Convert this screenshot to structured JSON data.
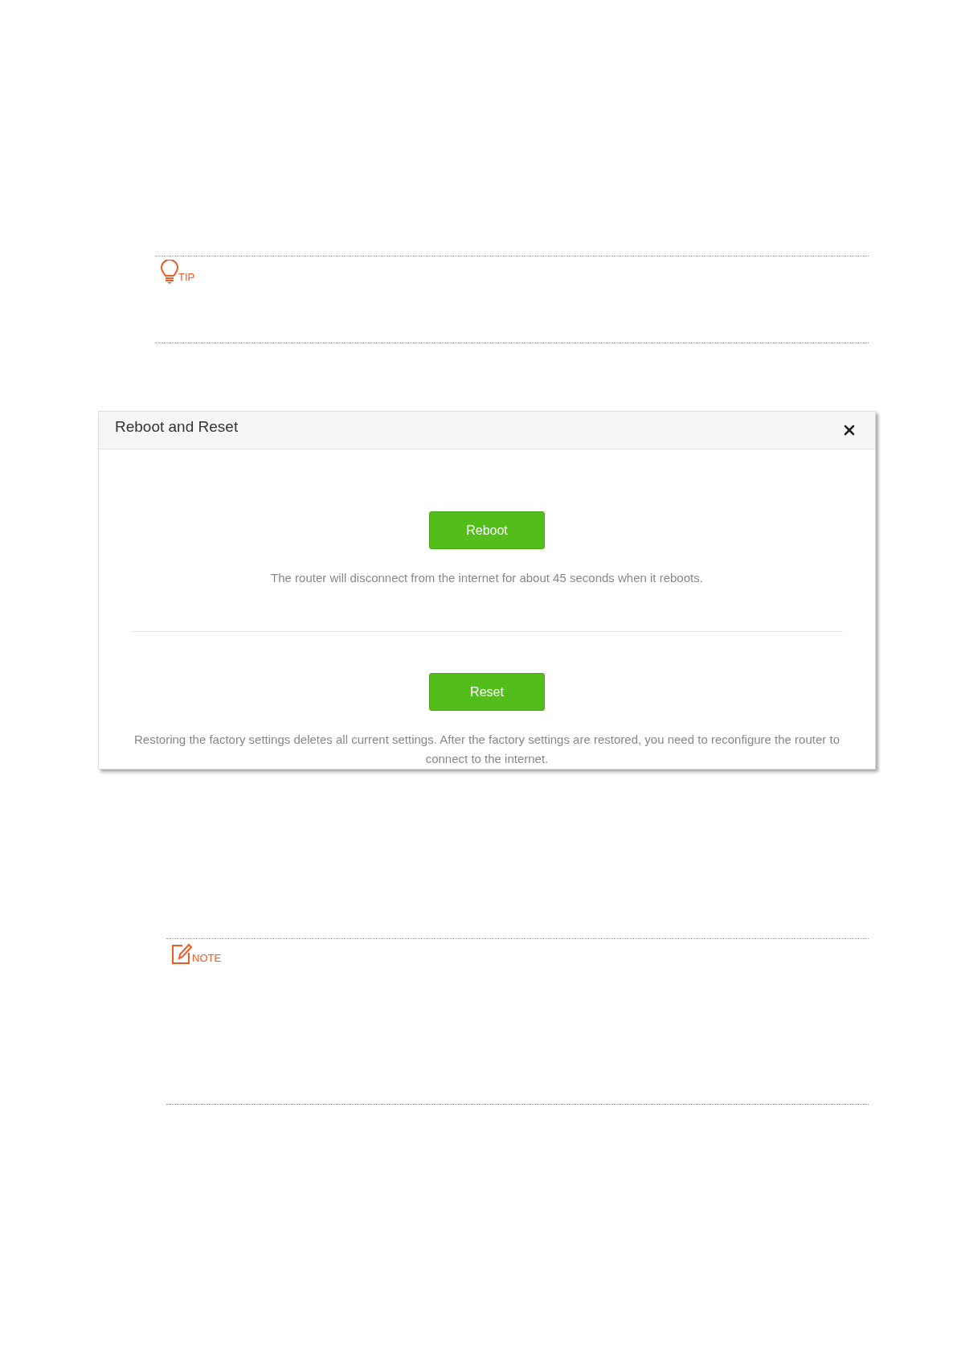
{
  "tip": {
    "kind": "tip",
    "label": "TIP"
  },
  "dialog": {
    "title": "Reboot and Reset",
    "sections": [
      {
        "button": "Reboot",
        "description": "The router will disconnect from the internet for about 45 seconds when it reboots."
      },
      {
        "button": "Reset",
        "description": "Restoring the factory settings deletes all current settings. After the factory settings are restored, you need to reconfigure the router to connect to the internet."
      }
    ]
  },
  "note": {
    "kind": "note",
    "label": "NOTE"
  }
}
